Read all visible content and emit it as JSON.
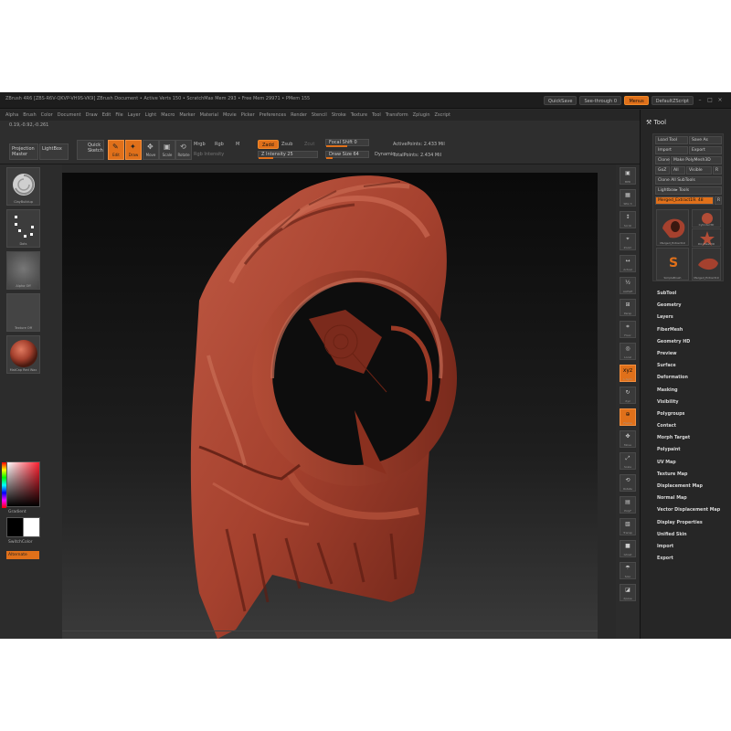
{
  "window": {
    "title": "ZBrush 4R6  [ZBS-R6V-QKVP-VH9S-VK9]   ZBrush Document    • Active Verts 150 • ScratchMax Mem 293 • Free Mem 29971 • PMem 155",
    "quicksave_label": "QuickSave",
    "seethrough_label": "See-through  0",
    "menus_label": "Menus",
    "script_label": "DefaultZScript",
    "window_buttons": [
      "–",
      "□",
      "×"
    ]
  },
  "menubar": {
    "items": [
      "Alpha",
      "Brush",
      "Color",
      "Document",
      "Draw",
      "Edit",
      "File",
      "Layer",
      "Light",
      "Macro",
      "Marker",
      "Material",
      "Movie",
      "Picker",
      "Preferences",
      "Render",
      "Stencil",
      "Stroke",
      "Texture",
      "Tool",
      "Transform",
      "Zplugin",
      "Zscript"
    ]
  },
  "toolbar": {
    "coords": "0.19,-0.92,-0.261",
    "projection_master": "Projection\nMaster",
    "lightbox": "LightBox",
    "quick_sketch": "Quick\nSketch",
    "edit": "Edit",
    "draw": "Draw",
    "move": "Move",
    "scale": "Scale",
    "rotate": "Rotate",
    "mrgb": "Mrgb",
    "rgb": "Rgb",
    "m": "M",
    "rgb_intensity": "Rgb Intensity",
    "zadd": "Zadd",
    "zsub": "Zsub",
    "zcut": "Zcut",
    "z_intensity": "Z Intensity 25",
    "focal_shift": "Focal Shift 0",
    "draw_size": "Draw Size 64",
    "dynamic": "Dynamic",
    "active_points": "ActivePoints: 2.433 Mil",
    "total_points": "TotalPoints: 2.434 Mil",
    "z_intensity_level": 0.25,
    "focal_shift_level": 0.5,
    "draw_size_level": 0.15
  },
  "leftshelf": {
    "brush_label": "ClayBuildup",
    "stroke_label": "Dots",
    "alpha_label": "Alpha Off",
    "texture_label": "Texture Off",
    "material_label": "MatCap Red Wax",
    "gradient_label": "Gradient",
    "switch_label": "SwitchColor",
    "alternate_label": "Alternate"
  },
  "rightshelf": {
    "buttons": [
      {
        "glyph": "▣",
        "label": "BPR"
      },
      {
        "glyph": "▦",
        "label": "SPix 3"
      },
      {
        "glyph": "↕",
        "label": "Scroll"
      },
      {
        "glyph": "⌖",
        "label": "Zoom"
      },
      {
        "glyph": "↔",
        "label": "Actual"
      },
      {
        "glyph": "½",
        "label": "AAHalf"
      },
      {
        "glyph": "⊞",
        "label": "Persp"
      },
      {
        "glyph": "⌗",
        "label": "Floor"
      },
      {
        "glyph": "◎",
        "label": "Local"
      },
      {
        "glyph": "xyz",
        "label": "L.Sym"
      },
      {
        "glyph": "↻",
        "label": "Xyz"
      },
      {
        "glyph": "⊕",
        "label": "Frame"
      },
      {
        "glyph": "✤",
        "label": "Move"
      },
      {
        "glyph": "⤢",
        "label": "Scale"
      },
      {
        "glyph": "⟲",
        "label": "Rotate"
      },
      {
        "glyph": "▤",
        "label": "PolyF"
      },
      {
        "glyph": "▧",
        "label": "Transp"
      },
      {
        "glyph": "■",
        "label": "Ghost"
      },
      {
        "glyph": "☂",
        "label": "Solo"
      },
      {
        "glyph": "◪",
        "label": "Xpose"
      }
    ]
  },
  "panel": {
    "title": "Tool",
    "buttons": {
      "load_tool": "Load Tool",
      "save_as": "Save As",
      "import": "Import",
      "export": "Export",
      "clone": "Clone",
      "make_polymesh": "Make PolyMesh3D",
      "goz": "GoZ",
      "all": "All",
      "visible": "Visible",
      "r": "R",
      "clone_all_subtools": "Clone All SubTools",
      "lightbox_tools": "Lightbox▸ Tools",
      "current_tool": "Merged_Extract19. 48",
      "r2": "R"
    },
    "tools": [
      {
        "label": "Merged_Extract19"
      },
      {
        "label": "Cylinder3D"
      },
      {
        "label": "PolyMesh3D"
      },
      {
        "label": "SimpleBrush"
      },
      {
        "label": "Merged_Extract19"
      }
    ],
    "menu_items": [
      "SubTool",
      "Geometry",
      "Layers",
      "FiberMesh",
      "Geometry HD",
      "Preview",
      "Surface",
      "Deformation",
      "Masking",
      "Visibility",
      "Polygroups",
      "Contact",
      "Morph Target",
      "Polypaint",
      "UV Map",
      "Texture Map",
      "Displacement Map",
      "Normal Map",
      "Vector Displacement Map",
      "Display Properties",
      "Unified Skin",
      "Import",
      "Export"
    ]
  },
  "colors": {
    "accent": "#e0701a",
    "model": "#a5412e",
    "background": "#2a2a2a"
  }
}
